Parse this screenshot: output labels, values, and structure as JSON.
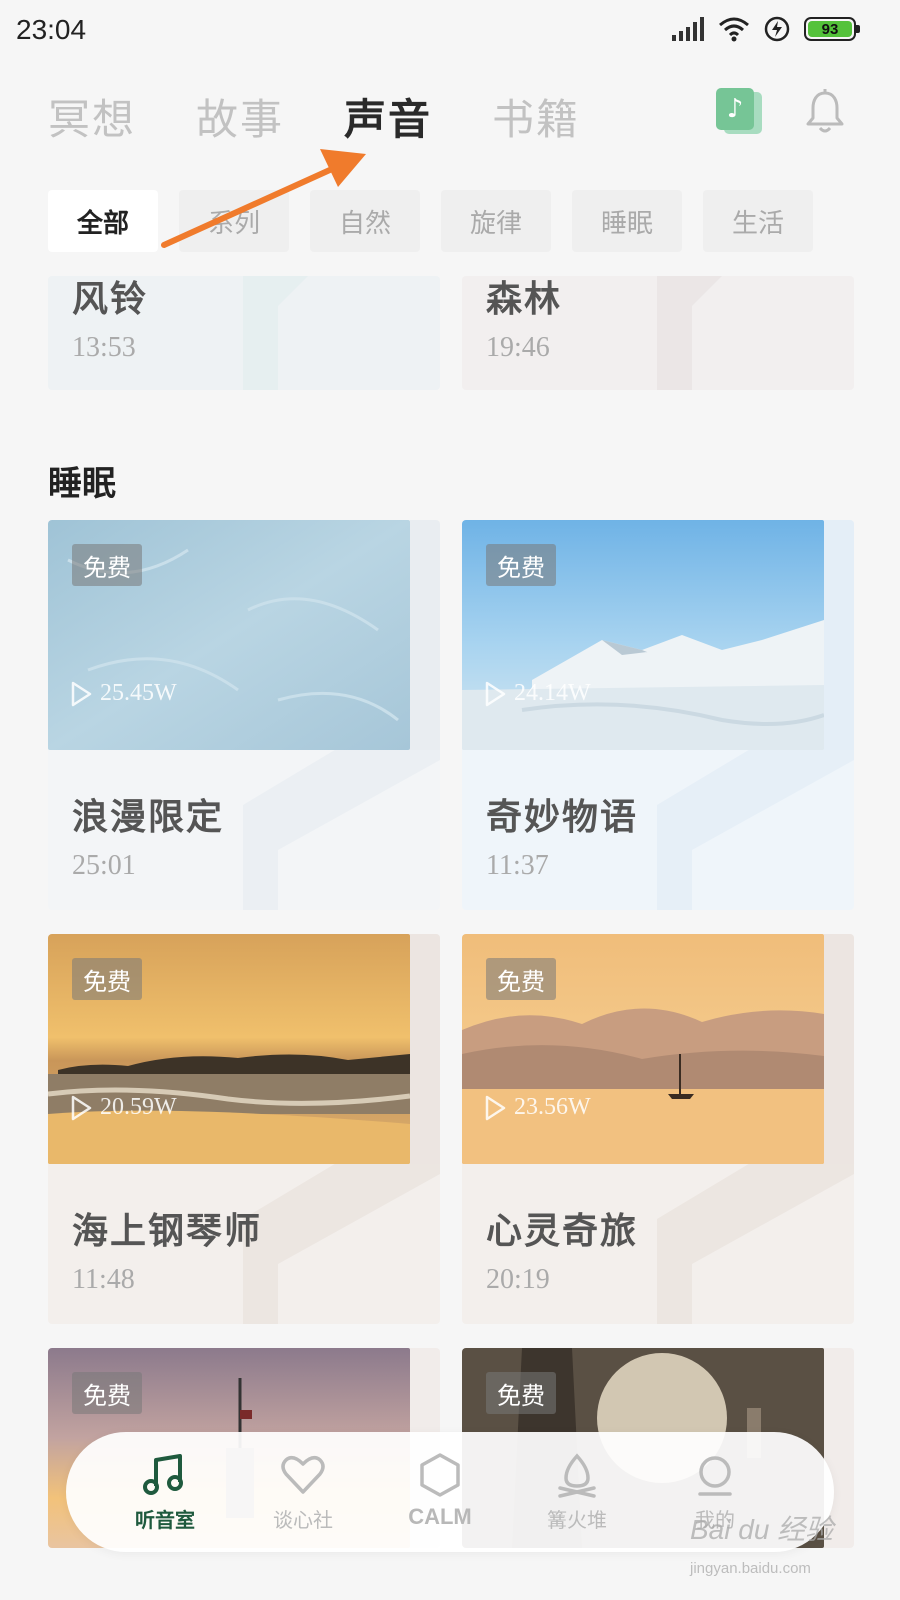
{
  "status": {
    "time": "23:04",
    "battery": "93"
  },
  "top_tabs": [
    "冥想",
    "故事",
    "声音",
    "书籍"
  ],
  "active_top_tab": "声音",
  "chips": [
    "全部",
    "系列",
    "自然",
    "旋律",
    "睡眠",
    "生活"
  ],
  "active_chip": "全部",
  "partial_cards": [
    {
      "title": "风铃",
      "duration": "13:53"
    },
    {
      "title": "森林",
      "duration": "19:46"
    }
  ],
  "section_title": "睡眠",
  "sleep_cards": [
    {
      "title": "浪漫限定",
      "duration": "25:01",
      "badge": "免费",
      "plays": "25.45W"
    },
    {
      "title": "奇妙物语",
      "duration": "11:37",
      "badge": "免费",
      "plays": "24.14W"
    },
    {
      "title": "海上钢琴师",
      "duration": "11:48",
      "badge": "免费",
      "plays": "20.59W"
    },
    {
      "title": "心灵奇旅",
      "duration": "20:19",
      "badge": "免费",
      "plays": "23.56W"
    },
    {
      "title": "",
      "duration": "",
      "badge": "免费",
      "plays": ""
    },
    {
      "title": "",
      "duration": "",
      "badge": "免费",
      "plays": ""
    }
  ],
  "bottom_nav": [
    {
      "label": "听音室",
      "icon": "music-note-icon"
    },
    {
      "label": "谈心社",
      "icon": "heart-icon"
    },
    {
      "label": "CALM",
      "icon": "hexagon-icon"
    },
    {
      "label": "篝火堆",
      "icon": "campfire-icon"
    },
    {
      "label": "我的",
      "icon": "profile-icon"
    }
  ],
  "active_nav": "听音室",
  "watermark": {
    "main": "Bai du 经验",
    "sub": "jingyan.baidu.com"
  },
  "colors": {
    "accent_green": "#1f5a3e",
    "annotation_arrow": "#f07b2c"
  }
}
